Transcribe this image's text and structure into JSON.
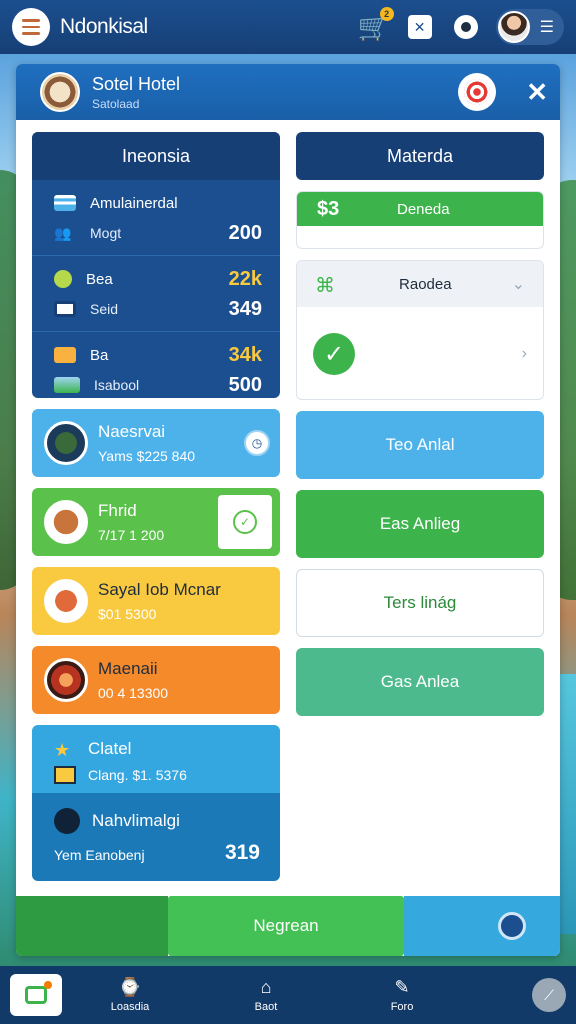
{
  "topbar": {
    "brand": "Ndonkisal",
    "cart_badge": "2",
    "icons": [
      "menu-icon",
      "cart-icon",
      "shuffle-icon",
      "location-icon",
      "avatar",
      "menu-lines-icon"
    ]
  },
  "card": {
    "title": "Sotel Hotel",
    "subtitle": "Satolaad"
  },
  "stats": {
    "header": "Ineonsia",
    "blocks": [
      {
        "row1_label": "Amulainerdal",
        "row2_label": "Mogt",
        "value": "200"
      },
      {
        "row1_label": "Bea",
        "row1_value": "22k",
        "row2_label": "Seid",
        "value": "349"
      },
      {
        "row1_label": "Ba",
        "row1_value": "34k",
        "row2_label": "Isabool",
        "value": "500"
      }
    ]
  },
  "tiles": [
    {
      "title": "Naesrvai",
      "sub": "Yams  $225 840",
      "color": "#4db2ea"
    },
    {
      "title": "Fhrid",
      "sub": "7/17  1 200",
      "color": "#5ac24a"
    },
    {
      "title": "Sayal Iob Mcnar",
      "sub": "$01 5300",
      "color": "#f9c93f"
    },
    {
      "title": "Maenaii",
      "sub": "00 4 13300",
      "color": "#f58a2b"
    }
  ],
  "bottom_panel": {
    "top_title": "Clatel",
    "top_sub": "Clang. $1. 5376",
    "bot_title": "Nahvlimalgi",
    "bot_sub": "Yem  Eanobenj",
    "bot_value": "319"
  },
  "right": {
    "header": "Materda",
    "green_card": {
      "price": "$3",
      "label": "Deneda"
    },
    "panel_title": "Raodea",
    "buttons": [
      {
        "label": "Teo Anlal",
        "style": "blue"
      },
      {
        "label": "Eas Anlieg",
        "style": "green"
      },
      {
        "label": "Ters linág",
        "style": "white"
      },
      {
        "label": "Gas Anlea",
        "style": "teal"
      }
    ]
  },
  "footer": {
    "action_label": "Negrean"
  },
  "bottom_nav": {
    "items": [
      {
        "label": "Loasdia",
        "icon": "history-icon"
      },
      {
        "label": "Baot",
        "icon": "home-icon"
      },
      {
        "label": "Foro",
        "icon": "edit-icon"
      }
    ]
  },
  "colors": {
    "navy": "#1c4f8f",
    "dark_navy": "#163f75",
    "green": "#3cb44b",
    "sky": "#4db2ea",
    "yellow": "#f9c93f",
    "orange": "#f58a2b"
  }
}
